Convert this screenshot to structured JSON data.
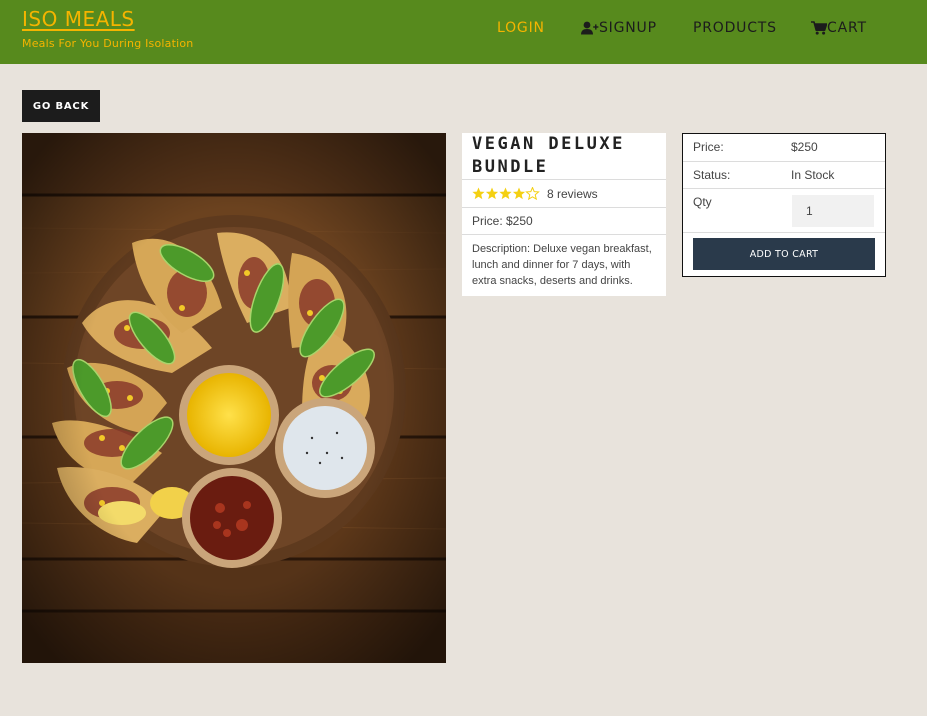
{
  "header": {
    "brand_title": "ISO MEALS",
    "brand_subtitle": "Meals For You During Isolation",
    "nav": {
      "login": "LOGIN",
      "signup": "SIGNUP",
      "signup_icon": "user-plus-icon",
      "products": "PRODUCTS",
      "cart": "CART",
      "cart_icon": "shopping-cart-icon"
    },
    "bg_color": "#578a1d",
    "accent_color": "#f5b400"
  },
  "go_back_label": "GO BACK",
  "product": {
    "image_alt": "tacos-platter",
    "name": "VEGAN DELUXE BUNDLE",
    "rating": 4,
    "rating_max": 5,
    "reviews_text": "8 reviews",
    "price_text": "Price: $250",
    "description": "Description: Deluxe vegan breakfast, lunch and dinner for 7 days, with extra snacks, deserts and drinks."
  },
  "purchase": {
    "price_label": "Price:",
    "price_value": "$250",
    "status_label": "Status:",
    "status_value": "In Stock",
    "qty_label": "Qty",
    "qty_value": "1",
    "add_to_cart_label": "ADD TO CART",
    "button_color": "#2a3a4b"
  }
}
